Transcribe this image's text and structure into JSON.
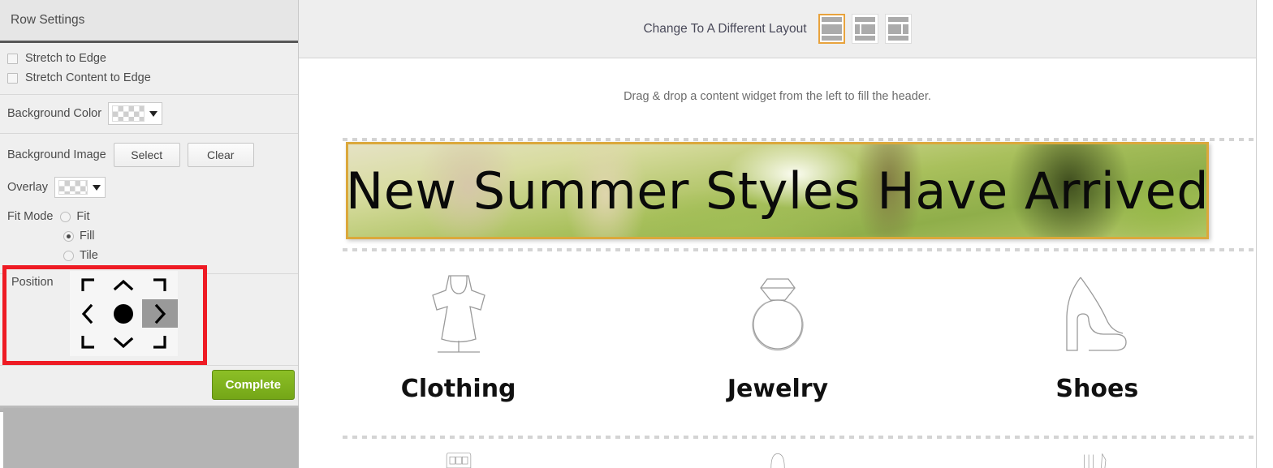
{
  "panel": {
    "title": "Row Settings",
    "checkboxes": [
      {
        "label": "Stretch to Edge",
        "checked": false
      },
      {
        "label": "Stretch Content to Edge",
        "checked": false
      }
    ],
    "background_color": {
      "label": "Background Color",
      "value": "transparent"
    },
    "background_image": {
      "label": "Background Image",
      "select_label": "Select",
      "clear_label": "Clear"
    },
    "overlay": {
      "label": "Overlay",
      "value": "transparent"
    },
    "fit_mode": {
      "label": "Fit Mode",
      "options": [
        "Fit",
        "Fill",
        "Tile"
      ],
      "selected": "Fill"
    },
    "position": {
      "label": "Position",
      "cells": [
        "top-left",
        "top-center",
        "top-right",
        "middle-left",
        "center",
        "middle-right",
        "bottom-left",
        "bottom-center",
        "bottom-right"
      ],
      "selected": "middle-right",
      "highlight_color": "#ee1b24"
    },
    "complete_label": "Complete"
  },
  "topbar": {
    "text": "Change To A Different Layout",
    "layouts": [
      {
        "name": "full-width",
        "selected": true
      },
      {
        "name": "narrow-left-wide-right",
        "selected": false
      },
      {
        "name": "wide-left-narrow-right",
        "selected": false
      }
    ],
    "accent": "#e8a33d"
  },
  "content": {
    "hint": "Drag & drop a content widget from the left to fill the header.",
    "banner": {
      "text": "New Summer Styles Have Arrived",
      "border_color": "#dba83b"
    },
    "categories": [
      {
        "label": "Clothing",
        "icon": "dress-icon"
      },
      {
        "label": "Jewelry",
        "icon": "ring-icon"
      },
      {
        "label": "Shoes",
        "icon": "high-heel-icon"
      }
    ],
    "categories_row2": [
      {
        "icon": "handbag-icon"
      },
      {
        "icon": "hat-icon"
      },
      {
        "icon": "accessories-icon"
      }
    ]
  }
}
